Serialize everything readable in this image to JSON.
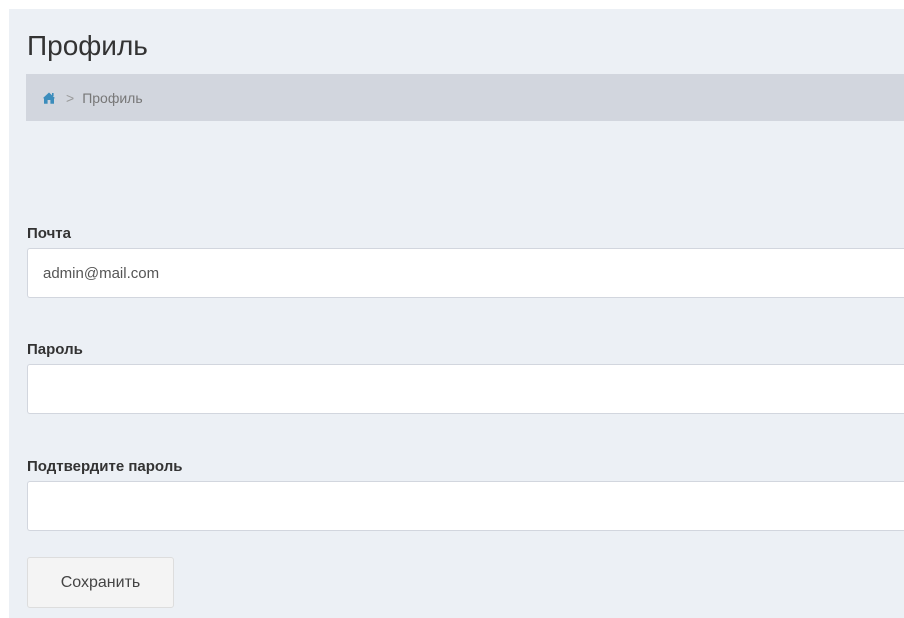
{
  "header": {
    "title": "Профиль"
  },
  "breadcrumb": {
    "separator": ">",
    "current": "Профиль",
    "home_icon": "home-icon"
  },
  "form": {
    "email_label": "Почта",
    "email_value": "admin@mail.com",
    "password_label": "Пароль",
    "password_value": "",
    "confirm_label": "Подтвердите пароль",
    "confirm_value": "",
    "save_label": "Сохранить"
  },
  "colors": {
    "content_bg": "#ecf0f5",
    "breadcrumb_bg": "#d2d6de",
    "icon": "#3c8dbc"
  }
}
